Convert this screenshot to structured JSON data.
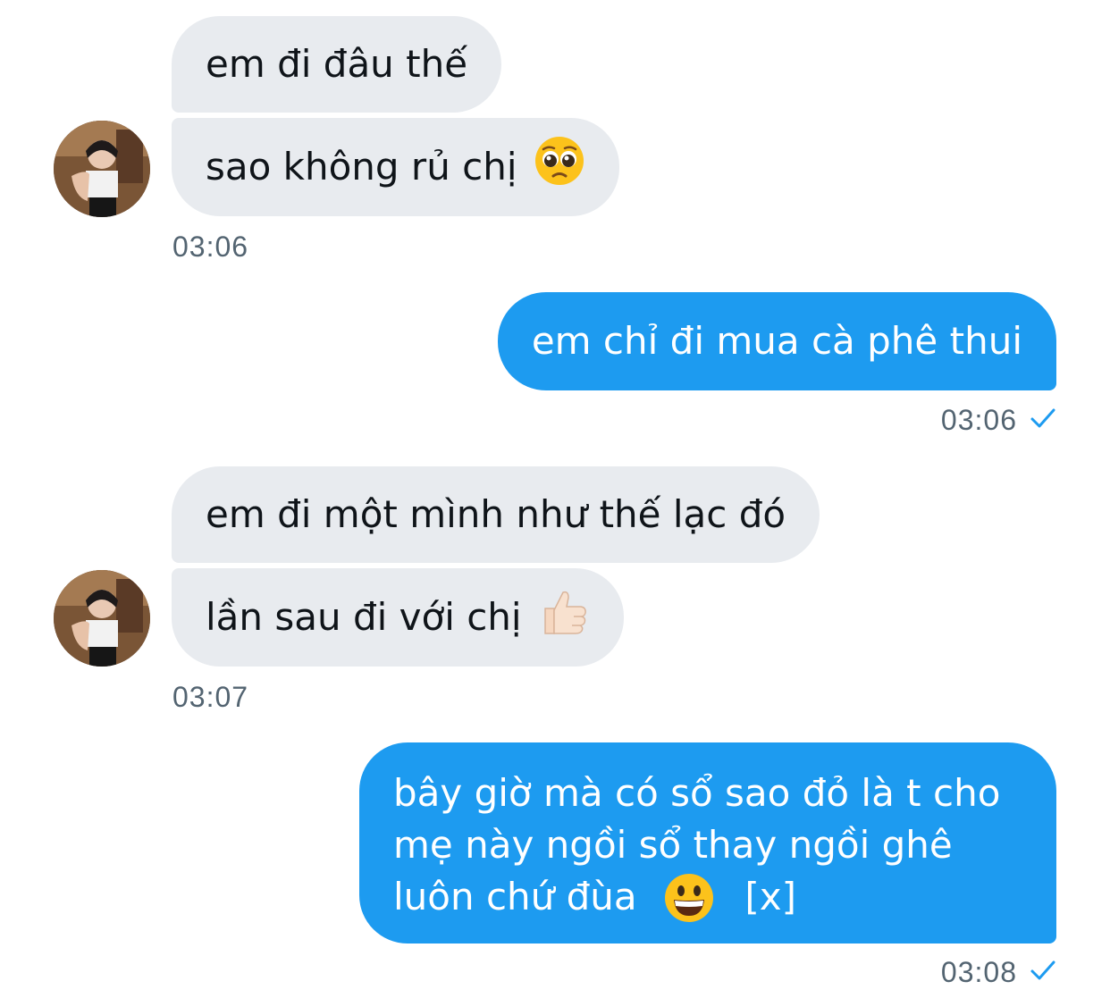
{
  "colors": {
    "incoming_bubble": "#e8ebef",
    "outgoing_bubble": "#1d9bf0",
    "timestamp": "#536471",
    "read_check": "#1d9bf0"
  },
  "messages": [
    {
      "group": "incoming",
      "bubbles": [
        {
          "text": "em đi đâu thế",
          "emoji": null
        },
        {
          "text": "sao không rủ chị",
          "emoji": "pleading-face-icon"
        }
      ],
      "time": "03:06"
    },
    {
      "group": "outgoing",
      "bubbles": [
        {
          "text": "em chỉ đi mua cà phê thui"
        }
      ],
      "time": "03:06",
      "status_icon": "read-check-icon"
    },
    {
      "group": "incoming",
      "bubbles": [
        {
          "text": "em đi một mình như thế lạc đó",
          "emoji": null
        },
        {
          "text": "lần sau đi với chị",
          "emoji": "thumbs-up-icon"
        }
      ],
      "time": "03:07"
    },
    {
      "group": "outgoing",
      "bubbles": [
        {
          "lines": [
            "bây giờ mà có sổ sao đỏ là t cho",
            "mẹ này ngồi sổ thay ngồi ghê",
            "luôn chứ đùa"
          ],
          "emoji": "grinning-face-icon",
          "suffix": "[x]"
        }
      ],
      "time": "03:08",
      "status_icon": "read-check-icon"
    }
  ]
}
